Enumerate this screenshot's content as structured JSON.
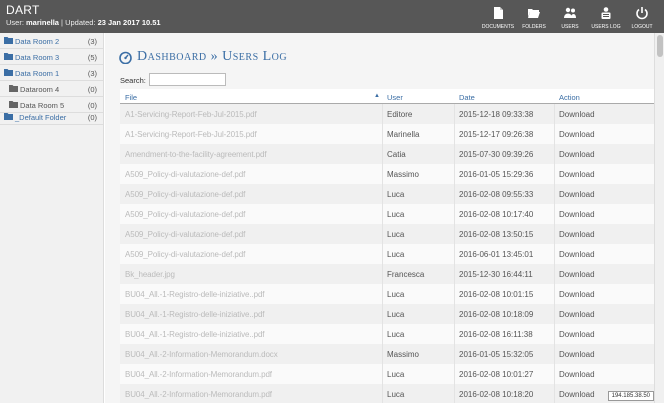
{
  "header": {
    "title": "DART",
    "user_prefix": "User:",
    "username": "marinella",
    "updated_prefix": "| Updated:",
    "updated": "23 Jan 2017 10.51",
    "nav": [
      {
        "label": "Documents",
        "icon": "document-icon"
      },
      {
        "label": "Folders",
        "icon": "folder-open-icon"
      },
      {
        "label": "Users",
        "icon": "users-icon"
      },
      {
        "label": "Users Log",
        "icon": "users-log-icon"
      },
      {
        "label": "Logout",
        "icon": "power-icon"
      }
    ]
  },
  "sidebar": {
    "items": [
      {
        "label": "Data Room 2",
        "count": "(3)",
        "type": "folder"
      },
      {
        "label": "Data Room 3",
        "count": "(5)",
        "type": "folder"
      },
      {
        "label": "Data Room 1",
        "count": "(3)",
        "type": "folder"
      },
      {
        "label": "Dataroom 4",
        "count": "(0)",
        "type": "sub"
      },
      {
        "label": "Data Room 5",
        "count": "(0)",
        "type": "sub"
      },
      {
        "label": "_Default Folder",
        "count": "(0)",
        "type": "folder"
      }
    ]
  },
  "main": {
    "title": "Dashboard » Users Log",
    "search_label": "Search:",
    "search_value": "",
    "columns": {
      "file": "File",
      "user": "User",
      "date": "Date",
      "action": "Action"
    },
    "rows": [
      {
        "file": "A1-Servicing-Report-Feb-Jul-2015.pdf",
        "user": "Editore",
        "date": "2015-12-18 09:33:38",
        "action": "Download"
      },
      {
        "file": "A1-Servicing-Report-Feb-Jul-2015.pdf",
        "user": "Marinella",
        "date": "2015-12-17 09:26:38",
        "action": "Download"
      },
      {
        "file": "Amendment-to-the-facility-agreement.pdf",
        "user": "Catia",
        "date": "2015-07-30 09:39:26",
        "action": "Download"
      },
      {
        "file": "A509_Policy-di-valutazione-def.pdf",
        "user": "Massimo",
        "date": "2016-01-05 15:29:36",
        "action": "Download"
      },
      {
        "file": "A509_Policy-di-valutazione-def.pdf",
        "user": "Luca",
        "date": "2016-02-08 09:55:33",
        "action": "Download"
      },
      {
        "file": "A509_Policy-di-valutazione-def.pdf",
        "user": "Luca",
        "date": "2016-02-08 10:17:40",
        "action": "Download"
      },
      {
        "file": "A509_Policy-di-valutazione-def.pdf",
        "user": "Luca",
        "date": "2016-02-08 13:50:15",
        "action": "Download"
      },
      {
        "file": "A509_Policy-di-valutazione-def.pdf",
        "user": "Luca",
        "date": "2016-06-01 13:45:01",
        "action": "Download"
      },
      {
        "file": "Bk_header.jpg",
        "user": "Francesca",
        "date": "2015-12-30 16:44:11",
        "action": "Download"
      },
      {
        "file": "BU04_All.-1-Registro-delle-iniziative..pdf",
        "user": "Luca",
        "date": "2016-02-08 10:01:15",
        "action": "Download"
      },
      {
        "file": "BU04_All.-1-Registro-delle-iniziative..pdf",
        "user": "Luca",
        "date": "2016-02-08 10:18:09",
        "action": "Download"
      },
      {
        "file": "BU04_All.-1-Registro-delle-iniziative..pdf",
        "user": "Luca",
        "date": "2016-02-08 16:11:38",
        "action": "Download"
      },
      {
        "file": "BU04_All.-2-Information-Memorandum.docx",
        "user": "Massimo",
        "date": "2016-01-05 15:32:05",
        "action": "Download"
      },
      {
        "file": "BU04_All.-2-Information-Memorandum.pdf",
        "user": "Luca",
        "date": "2016-02-08 10:01:27",
        "action": "Download"
      },
      {
        "file": "BU04_All.-2-Information-Memorandum.pdf",
        "user": "Luca",
        "date": "2016-02-08 10:18:20",
        "action": "Download"
      }
    ]
  },
  "ip_address": "194.185.38.50",
  "colors": {
    "header_bg": "#575757",
    "accent": "#3b6ea5",
    "sidebar_bg": "#f1f1f1"
  }
}
